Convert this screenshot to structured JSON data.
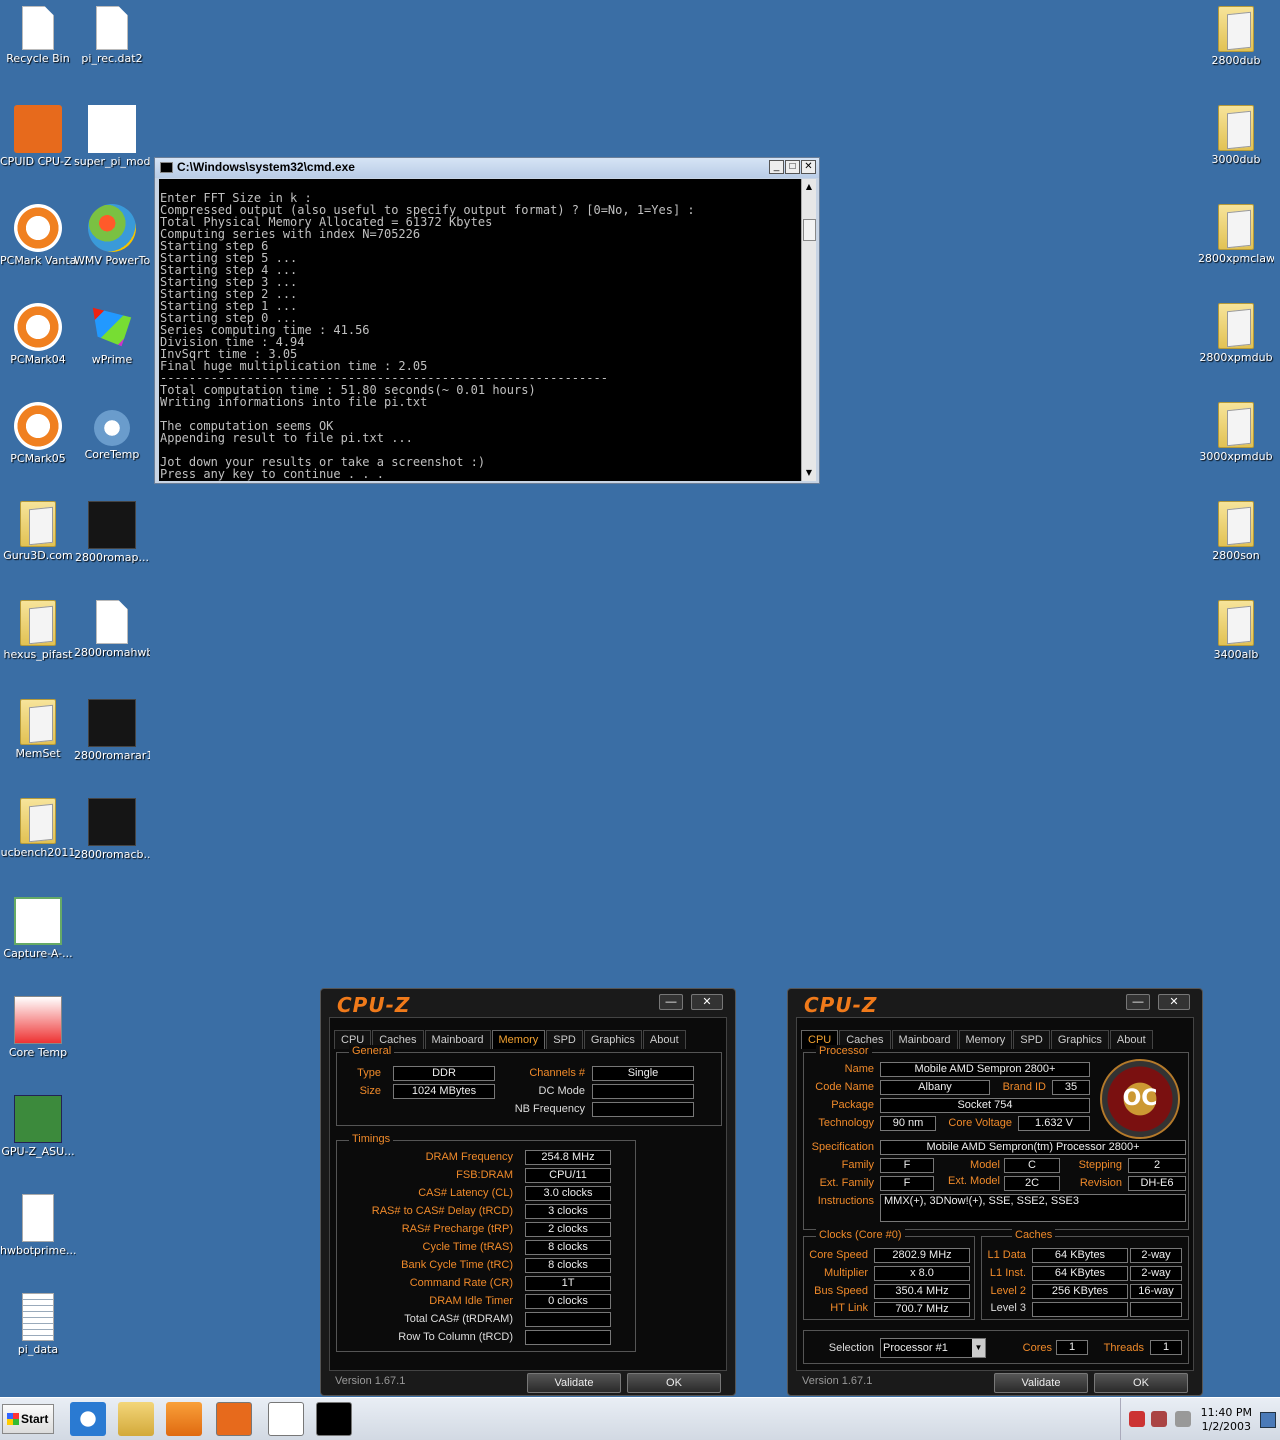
{
  "desktop_left": [
    {
      "label": "Recycle Bin",
      "icon": "recycle-bin-icon"
    },
    {
      "label": "pi_rec.dat2",
      "icon": "file-icon"
    },
    {
      "label": "CPUID CPU-Z OC",
      "icon": "cpuz-oc-icon"
    },
    {
      "label": "super_pi_mod",
      "icon": "super-pi-icon"
    },
    {
      "label": "PCMark Vantage",
      "icon": "pcmark-icon"
    },
    {
      "label": "WMV PowerToy",
      "icon": "wmv-icon"
    },
    {
      "label": "PCMark04",
      "icon": "pcmark-icon"
    },
    {
      "label": "wPrime",
      "icon": "wprime-icon"
    },
    {
      "label": "PCMark05",
      "icon": "pcmark-icon"
    },
    {
      "label": "CoreTemp",
      "icon": "coretemp-icon"
    },
    {
      "label": "Guru3D.com",
      "icon": "folder-icon"
    },
    {
      "label": "2800romap...",
      "icon": "image-icon"
    },
    {
      "label": "hexus_pifast",
      "icon": "folder-icon"
    },
    {
      "label": "2800romahwb",
      "icon": "file-icon"
    },
    {
      "label": "MemSet",
      "icon": "folder-icon"
    },
    {
      "label": "2800romarar1",
      "icon": "image-icon"
    },
    {
      "label": "ucbench2011",
      "icon": "folder-icon"
    },
    {
      "label": "2800romacb...",
      "icon": "image-icon"
    },
    {
      "label": "Capture-A-...",
      "icon": "capture-icon"
    },
    {
      "label": "Core Temp",
      "icon": "core-temp-icon"
    },
    {
      "label": "GPU-Z_ASU...",
      "icon": "gpuz-icon"
    },
    {
      "label": "hwbotprime...",
      "icon": "java-icon"
    },
    {
      "label": "pi_data",
      "icon": "text-file-icon"
    }
  ],
  "desktop_right": [
    {
      "label": "2800dub"
    },
    {
      "label": "3000dub"
    },
    {
      "label": "2800xpmclaw"
    },
    {
      "label": "2800xpmdub"
    },
    {
      "label": "3000xpmdub"
    },
    {
      "label": "2800son"
    },
    {
      "label": "3400alb"
    }
  ],
  "cmd": {
    "title": "C:\\Windows\\system32\\cmd.exe",
    "btn_min": "_",
    "btn_max": "□",
    "btn_close": "✕",
    "output": "Enter FFT Size in k :\nCompressed output (also useful to specify output format) ? [0=No, 1=Yes] :\nTotal Physical Memory Allocated = 61372 Kbytes\nComputing series with index N=705226\nStarting step 6\nStarting step 5 ...\nStarting step 4 ...\nStarting step 3 ...\nStarting step 2 ...\nStarting step 1 ...\nStarting step 0 ...\nSeries computing time : 41.56\nDivision time : 4.94\nInvSqrt time : 3.05\nFinal huge multiplication time : 2.05\n--------------------------------------------------------------\nTotal computation time : 51.80 seconds(~ 0.01 hours)\nWriting informations into file pi.txt\n\nThe computation seems OK\nAppending result to file pi.txt ...\n\nJot down your results or take a screenshot :)\nPress any key to continue . . ."
  },
  "cpuz_common": {
    "logo": "CPU-Z",
    "version": "Version 1.67.1",
    "validate": "Validate",
    "ok": "OK",
    "btn_min": "—",
    "btn_close": "✕",
    "tabs": [
      "CPU",
      "Caches",
      "Mainboard",
      "Memory",
      "SPD",
      "Graphics",
      "About"
    ]
  },
  "mem": {
    "general_title": "General",
    "type_label": "Type",
    "type": "DDR",
    "size_label": "Size",
    "size": "1024 MBytes",
    "channels_label": "Channels #",
    "channels": "Single",
    "dcmode_label": "DC Mode",
    "dcmode": "",
    "nbfreq_label": "NB Frequency",
    "nbfreq": "",
    "timings_title": "Timings",
    "timings": [
      {
        "label": "DRAM Frequency",
        "value": "254.8 MHz"
      },
      {
        "label": "FSB:DRAM",
        "value": "CPU/11"
      },
      {
        "label": "CAS# Latency (CL)",
        "value": "3.0 clocks"
      },
      {
        "label": "RAS# to CAS# Delay (tRCD)",
        "value": "3 clocks"
      },
      {
        "label": "RAS# Precharge (tRP)",
        "value": "2 clocks"
      },
      {
        "label": "Cycle Time (tRAS)",
        "value": "8 clocks"
      },
      {
        "label": "Bank Cycle Time (tRC)",
        "value": "8 clocks"
      },
      {
        "label": "Command Rate (CR)",
        "value": "1T"
      },
      {
        "label": "DRAM Idle Timer",
        "value": "0 clocks"
      },
      {
        "label": "Total CAS# (tRDRAM)",
        "value": ""
      },
      {
        "label": "Row To Column (tRCD)",
        "value": ""
      }
    ]
  },
  "cpu": {
    "processor_title": "Processor",
    "name_label": "Name",
    "name": "Mobile AMD Sempron 2800+",
    "codename_label": "Code Name",
    "codename": "Albany",
    "brandid_label": "Brand ID",
    "brandid": "35",
    "package_label": "Package",
    "package": "Socket 754",
    "tech_label": "Technology",
    "tech": "90 nm",
    "voltage_label": "Core Voltage",
    "voltage": "1.632 V",
    "spec_label": "Specification",
    "spec": "Mobile AMD Sempron(tm) Processor 2800+",
    "family_label": "Family",
    "family": "F",
    "model_label": "Model",
    "model": "C",
    "stepping_label": "Stepping",
    "stepping": "2",
    "extfamily_label": "Ext. Family",
    "extfamily": "F",
    "extmodel_label": "Ext. Model",
    "extmodel": "2C",
    "revision_label": "Revision",
    "revision": "DH-E6",
    "instr_label": "Instructions",
    "instr": "MMX(+), 3DNow!(+), SSE, SSE2, SSE3",
    "badge": "OC",
    "clocks_title": "Clocks (Core #0)",
    "corespeed_label": "Core Speed",
    "corespeed": "2802.9 MHz",
    "mult_label": "Multiplier",
    "mult": "x 8.0",
    "bus_label": "Bus Speed",
    "bus": "350.4 MHz",
    "ht_label": "HT Link",
    "ht": "700.7 MHz",
    "caches_title": "Caches",
    "l1d_label": "L1 Data",
    "l1d": "64 KBytes",
    "l1d_way": "2-way",
    "l1i_label": "L1 Inst.",
    "l1i": "64 KBytes",
    "l1i_way": "2-way",
    "l2_label": "Level 2",
    "l2": "256 KBytes",
    "l2_way": "16-way",
    "l3_label": "Level 3",
    "l3": "",
    "l3_way": "",
    "selection_label": "Selection",
    "selection": "Processor #1",
    "cores_label": "Cores",
    "cores": "1",
    "threads_label": "Threads",
    "threads": "1"
  },
  "taskbar": {
    "start": "Start",
    "time": "11:40 PM",
    "date": "1/2/2003",
    "items": [
      "internet-explorer-icon",
      "explorer-icon",
      "media-player-icon",
      "cpuz-oc-icon",
      "capture-icon",
      "cmd-icon"
    ]
  }
}
